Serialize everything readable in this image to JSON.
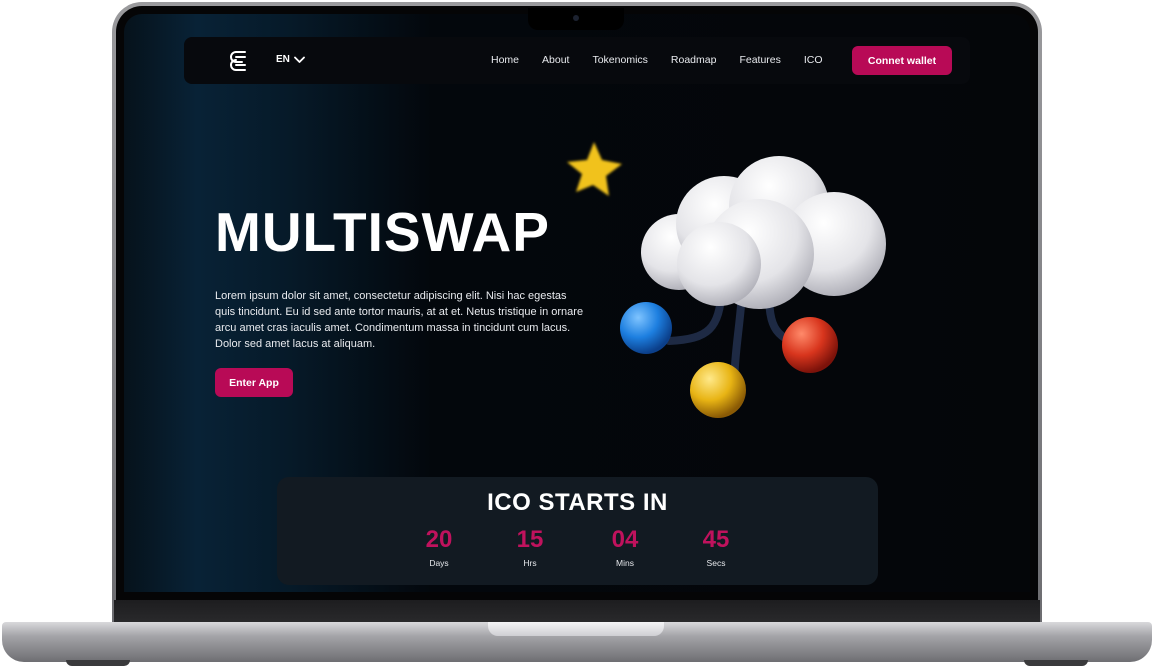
{
  "navbar": {
    "language": "EN",
    "links": [
      "Home",
      "About",
      "Tokenomics",
      "Roadmap",
      "Features",
      "ICO"
    ],
    "connect_label": "Connet wallet"
  },
  "hero": {
    "title": "MULTISWAP",
    "description": "Lorem ipsum dolor sit amet, consectetur adipiscing elit. Nisi hac egestas quis tincidunt. Eu id sed ante tortor mauris, at at et. Netus tristique in ornare arcu amet cras iaculis amet. Condimentum massa in tincidunt cum lacus. Dolor sed amet lacus at aliquam.",
    "cta_label": "Enter App"
  },
  "countdown": {
    "title": "ICO STARTS IN",
    "units": [
      {
        "value": "20",
        "label": "Days"
      },
      {
        "value": "15",
        "label": "Hrs"
      },
      {
        "value": "04",
        "label": "Mins"
      },
      {
        "value": "45",
        "label": "Secs"
      }
    ]
  },
  "colors": {
    "accent": "#b80a56",
    "countdown_digits": "#c0125d",
    "background": "#040609"
  },
  "icons": {
    "logo": "stacked-e-logo-icon",
    "language_chevron": "chevron-down-icon",
    "illustration": "cloud-network-illustration"
  }
}
